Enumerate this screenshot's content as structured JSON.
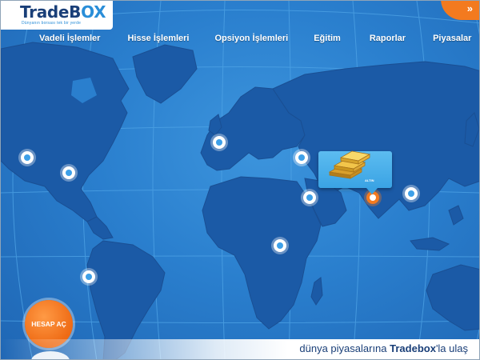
{
  "logo": {
    "brand_main": "TradeB",
    "brand_accent": "OX",
    "tagline": "Dünyanın borsası tek bir yerde"
  },
  "corner_button": {
    "icon": "double-chevron-right-icon",
    "glyph": "»"
  },
  "nav": {
    "items": [
      "Vadeli İşlemler",
      "Hisse İşlemleri",
      "Opsiyon İşlemleri",
      "Eğitim",
      "Raporlar",
      "Piyasalar"
    ]
  },
  "popup": {
    "label": "ALTIN",
    "icon": "gold-bars-icon"
  },
  "cta": {
    "label": "HESAP AÇ"
  },
  "footer": {
    "slogan_before": "dünya piyasalarına ",
    "slogan_brand": "Tradebox",
    "slogan_after": "'la ulaş"
  },
  "colors": {
    "ocean": "#2a7fce",
    "land": "#1b5aa6",
    "accent_orange": "#f37a1f",
    "brand_navy": "#1a3f78",
    "brand_light": "#2a8ed8"
  }
}
